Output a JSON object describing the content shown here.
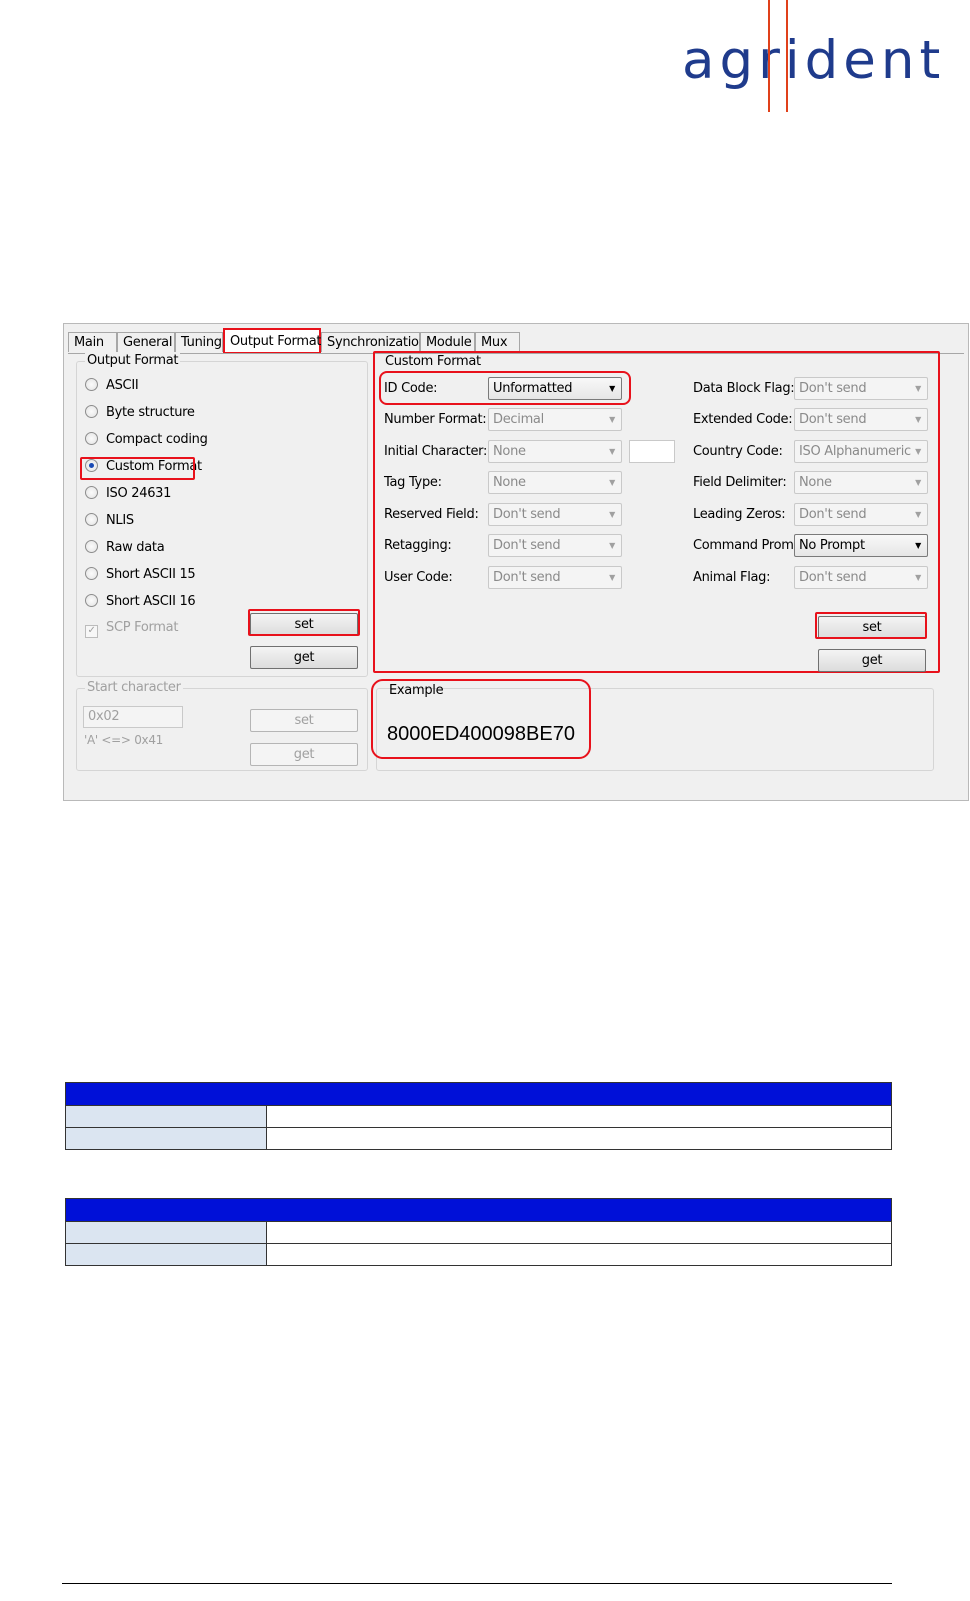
{
  "logo": {
    "text": "agrident"
  },
  "tabs": [
    "Main",
    "General",
    "Tuning",
    "Output Format",
    "Synchronization",
    "Module",
    "Mux"
  ],
  "active_tab": "Output Format",
  "output_format": {
    "title": "Output Format",
    "options": [
      "ASCII",
      "Byte structure",
      "Compact coding",
      "Custom Format",
      "ISO 24631",
      "NLIS",
      "Raw data",
      "Short ASCII 15",
      "Short ASCII 16"
    ],
    "selected": "Custom Format",
    "scp_label": "SCP Format",
    "set_label": "set",
    "get_label": "get"
  },
  "start_character": {
    "title": "Start character",
    "value": "0x02",
    "hint": "'A' <=> 0x41",
    "set_label": "set",
    "get_label": "get"
  },
  "custom_format": {
    "title": "Custom Format",
    "left_fields": [
      {
        "label": "ID Code:",
        "value": "Unformatted"
      },
      {
        "label": "Number Format:",
        "value": "Decimal"
      },
      {
        "label": "Initial Character:",
        "value": "None"
      },
      {
        "label": "Tag Type:",
        "value": "None"
      },
      {
        "label": "Reserved Field:",
        "value": "Don't send"
      },
      {
        "label": "Retagging:",
        "value": "Don't send"
      },
      {
        "label": "User Code:",
        "value": "Don't send"
      }
    ],
    "right_fields": [
      {
        "label": "Data Block Flag:",
        "value": "Don't send"
      },
      {
        "label": "Extended Code:",
        "value": "Don't send"
      },
      {
        "label": "Country Code:",
        "value": "ISO Alphanumeric"
      },
      {
        "label": "Field Delimiter:",
        "value": "None"
      },
      {
        "label": "Leading Zeros:",
        "value": "Don't send"
      },
      {
        "label": "Command Prompt:",
        "value": "No Prompt"
      },
      {
        "label": "Animal Flag:",
        "value": "Don't send"
      }
    ],
    "initial_char_text": "",
    "set_label": "set",
    "get_label": "get"
  },
  "example": {
    "title": "Example",
    "value": "8000ED400098BE70"
  }
}
